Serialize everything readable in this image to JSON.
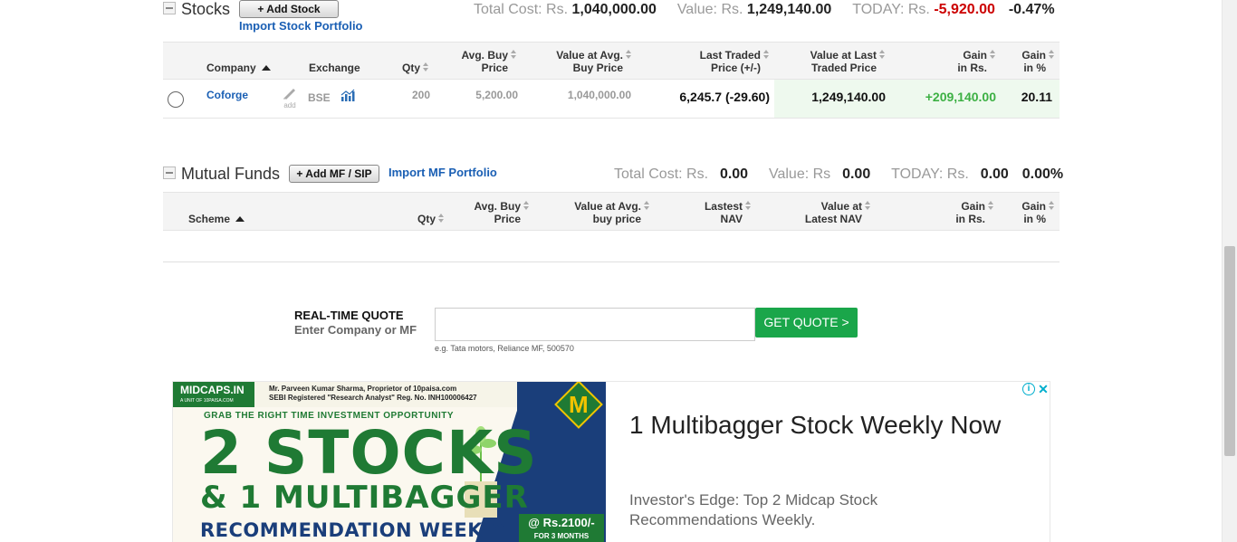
{
  "stocks": {
    "title": "Stocks",
    "add_button": "+ Add Stock",
    "import_link": "Import Stock Portfolio",
    "summary": {
      "total_cost_label": "Total Cost: Rs.",
      "total_cost_value": "1,040,000.00",
      "value_label": "Value: Rs.",
      "value_value": "1,249,140.00",
      "today_label": "TODAY: Rs.",
      "today_value": "-5,920.00",
      "today_pct": "-0.47%"
    },
    "columns": {
      "company": "Company",
      "exchange": "Exchange",
      "qty": "Qty",
      "avg_buy_1": "Avg. Buy",
      "avg_buy_2": "Price",
      "value_avg_1": "Value at Avg.",
      "value_avg_2": "Buy Price",
      "last_traded_1": "Last Traded",
      "last_traded_2": "Price (+/-)",
      "value_last_1": "Value at Last",
      "value_last_2": "Traded Price",
      "gain_rs_1": "Gain",
      "gain_rs_2": "in Rs.",
      "gain_pct_1": "Gain",
      "gain_pct_2": "in %"
    },
    "rows": [
      {
        "company": "Coforge",
        "add_label": "add",
        "exchange": "BSE",
        "qty": "200",
        "avg_buy": "5,200.00",
        "value_avg": "1,040,000.00",
        "last_traded": "6,245.7 (-29.60)",
        "value_last": "1,249,140.00",
        "gain_rs": "+209,140.00",
        "gain_pct": "20.11"
      }
    ]
  },
  "mutual_funds": {
    "title": "Mutual Funds",
    "add_button": "+ Add MF / SIP",
    "import_link": "Import MF Portfolio",
    "summary": {
      "total_cost_label": "Total Cost: Rs.",
      "total_cost_value": "0.00",
      "value_label": "Value: Rs",
      "value_value": "0.00",
      "today_label": "TODAY: Rs.",
      "today_value": "0.00",
      "today_pct": "0.00%"
    },
    "columns": {
      "scheme": "Scheme",
      "qty": "Qty",
      "avg_buy_1": "Avg. Buy",
      "avg_buy_2": "Price",
      "value_avg_1": "Value at Avg.",
      "value_avg_2": "buy price",
      "latest_nav_1": "Lastest",
      "latest_nav_2": "NAV",
      "value_nav_1": "Value at",
      "value_nav_2": "Latest NAV",
      "gain_rs_1": "Gain",
      "gain_rs_2": "in Rs.",
      "gain_pct_1": "Gain",
      "gain_pct_2": "in %"
    }
  },
  "quote": {
    "title": "REAL-TIME QUOTE",
    "subtitle": "Enter Company or MF",
    "input_value": "",
    "example": "e.g. Tata motors, Reliance MF, 500570",
    "button": "GET QUOTE >"
  },
  "ad": {
    "logo_main": "MIDCAPS.IN",
    "logo_sub": "A UNIT OF 10PAISA.COM",
    "fine_line1": "Mr. Parveen Kumar Sharma, Proprietor of 10paisa.com",
    "fine_line2": "SEBI Registered \"Research Analyst\" Reg. No. INH100006427",
    "grab_line": "GRAB THE RIGHT TIME INVESTMENT OPPORTUNITY",
    "big1": "2 STOCKS",
    "big2": "& 1 MULTIBAGGER",
    "big3": "RECOMMENDATION WEEKLY",
    "badge": "M",
    "price": "@ Rs.2100/-",
    "price_sub": "FOR 3 MONTHS",
    "headline": "1 Multibagger Stock Weekly Now",
    "description": "Investor's Edge: Top 2 Midcap Stock Recommendations Weekly.",
    "colors": {
      "green": "#1f7a34",
      "navy": "#1a3e7a",
      "gold": "#f2c300"
    }
  },
  "colors": {
    "link": "#1a5fb4",
    "negative": "#cc0000",
    "positive": "#3cb043",
    "quote_button": "#1aa64a"
  }
}
